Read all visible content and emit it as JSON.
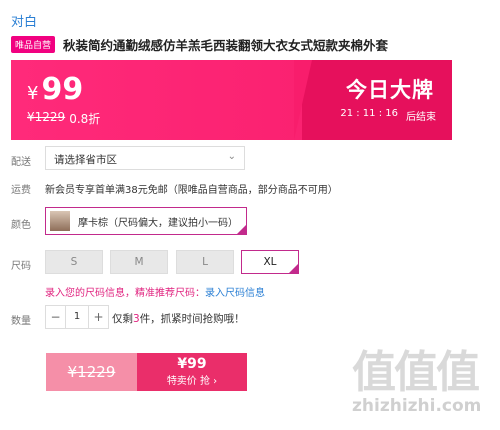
{
  "header": {
    "brand": "对白",
    "badge": "唯品自营",
    "title": "秋装简约通勤绒感仿羊羔毛西装翻领大衣女式短款夹棉外套"
  },
  "price": {
    "currency": "¥",
    "current": "99",
    "original": "¥1229",
    "discount": "0.8折",
    "deal_title": "今日大牌",
    "countdown": "21 : 11 : 16",
    "countdown_suffix": "后结束"
  },
  "delivery": {
    "label": "配送",
    "region_placeholder": "请选择省市区"
  },
  "shipping": {
    "label": "运费",
    "text": "新会员专享首单满38元免邮（限唯品自营商品，部分商品不可用）"
  },
  "color": {
    "label": "颜色",
    "selected": "摩卡棕（尺码偏大，建议拍小一码）"
  },
  "size": {
    "label": "尺码",
    "options": [
      "S",
      "M",
      "L",
      "XL"
    ],
    "selected": "XL"
  },
  "size_hint": {
    "pink": "录入您的尺码信息，精准推荐尺码：",
    "link": "录入尺码信息"
  },
  "quantity": {
    "label": "数量",
    "minus": "−",
    "value": "1",
    "plus": "+",
    "stock_prefix": "仅剩",
    "stock_count": "3",
    "stock_suffix": "件，抓紧时间抢购哦！"
  },
  "buy": {
    "original": "¥1229",
    "price": "¥99",
    "label": "特卖价 抢 ›"
  },
  "watermark": {
    "glyphs": "值值值",
    "url": "zhizhizhi.com"
  },
  "colors": {
    "accent": "#f81d6c",
    "pink_border": "#c22a8c",
    "link": "#2a7fd4"
  }
}
